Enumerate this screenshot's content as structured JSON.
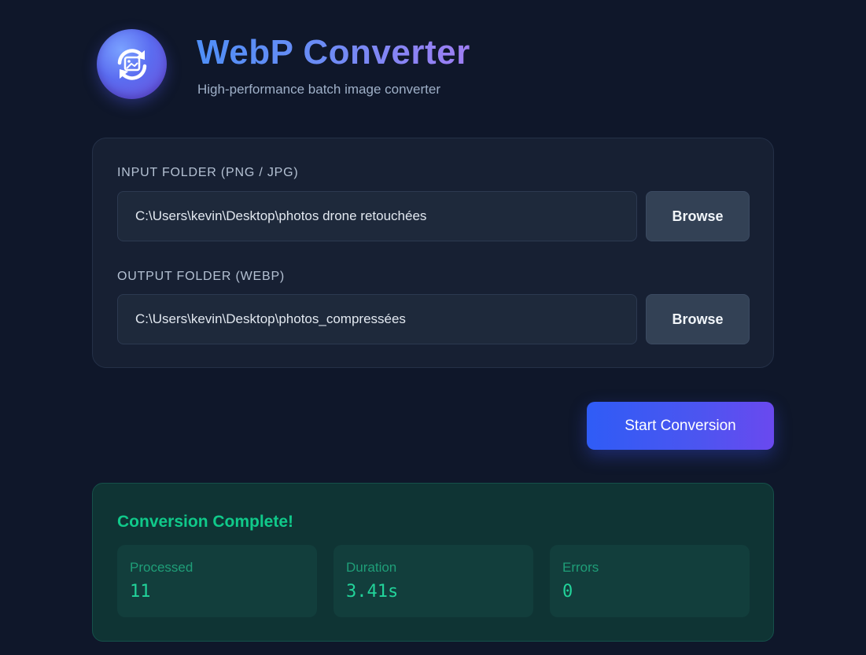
{
  "header": {
    "title": "WebP Converter",
    "subtitle": "High-performance batch image converter",
    "logo_icon": "refresh-image-icon"
  },
  "folders": {
    "input": {
      "label": "INPUT FOLDER (PNG / JPG)",
      "value": "C:\\Users\\kevin\\Desktop\\photos drone retouchées",
      "browse_label": "Browse"
    },
    "output": {
      "label": "OUTPUT FOLDER (WEBP)",
      "value": "C:\\Users\\kevin\\Desktop\\photos_compressées",
      "browse_label": "Browse"
    }
  },
  "actions": {
    "start_label": "Start Conversion"
  },
  "result": {
    "title": "Conversion Complete!",
    "stats": [
      {
        "label": "Processed",
        "value": "11"
      },
      {
        "label": "Duration",
        "value": "3.41s"
      },
      {
        "label": "Errors",
        "value": "0"
      }
    ]
  },
  "colors": {
    "background": "#0f172a",
    "accent": "#4c55f0",
    "success": "#10c98a"
  }
}
